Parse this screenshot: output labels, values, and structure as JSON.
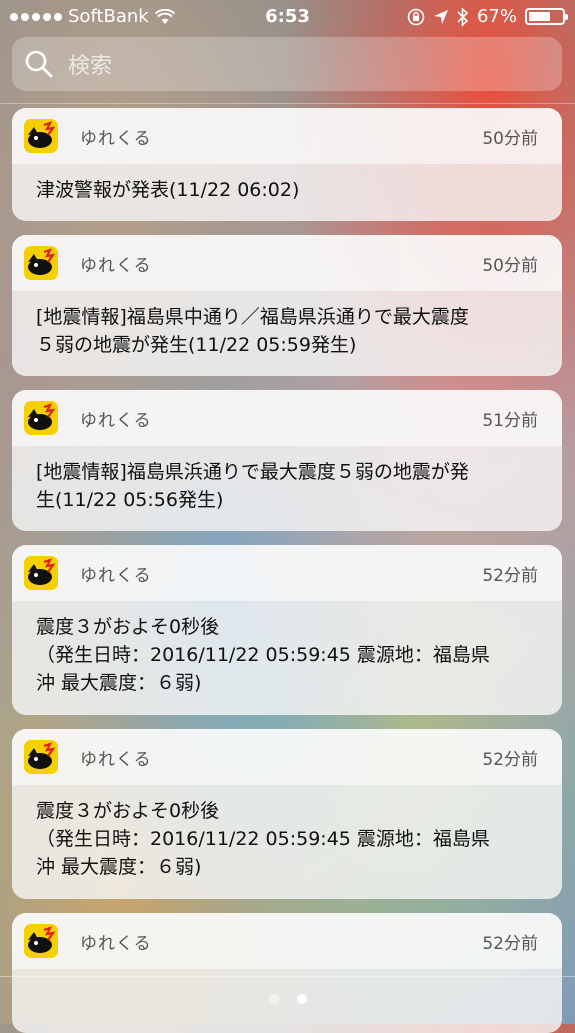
{
  "status_bar": {
    "carrier": "SoftBank",
    "time": "6:53",
    "battery": "67%",
    "battery_level": 0.67,
    "signal_bars": 5
  },
  "search": {
    "placeholder": "検索"
  },
  "notifications": [
    {
      "app": "ゆれくる",
      "time": "50分前",
      "message": "津波警報が発表(11/22 06:02)"
    },
    {
      "app": "ゆれくる",
      "time": "50分前",
      "message": "[地震情報]福島県中通り／福島県浜通りで最大震度\n５弱の地震が発生(11/22 05:59発生)"
    },
    {
      "app": "ゆれくる",
      "time": "51分前",
      "message": "[地震情報]福島県浜通りで最大震度５弱の地震が発\n生(11/22 05:56発生)"
    },
    {
      "app": "ゆれくる",
      "time": "52分前",
      "message": "震度３がおよそ0秒後\n（発生日時：2016/11/22 05:59:45 震源地：福島県\n沖 最大震度：６弱)"
    },
    {
      "app": "ゆれくる",
      "time": "52分前",
      "message": "震度３がおよそ0秒後\n（発生日時：2016/11/22 05:59:45 震源地：福島県\n沖 最大震度：６弱)"
    },
    {
      "app": "ゆれくる",
      "time": "52分前",
      "message": ""
    }
  ],
  "pager": {
    "pages": 2,
    "active": 1
  },
  "colors": {
    "app_icon_bg": "#f5d000"
  }
}
